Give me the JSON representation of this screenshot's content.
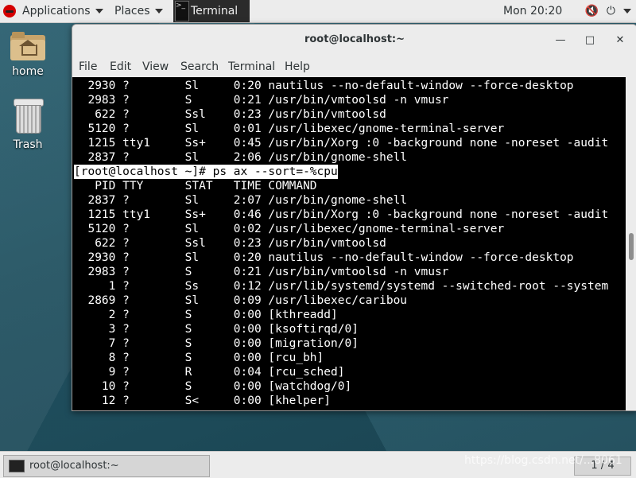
{
  "top_panel": {
    "applications": "Applications",
    "places": "Places",
    "terminal_task": "Terminal",
    "clock": "Mon 20:20"
  },
  "desktop": {
    "home_label": "home",
    "trash_label": "Trash"
  },
  "window": {
    "title": "root@localhost:~",
    "menu": [
      "File",
      "Edit",
      "View",
      "Search",
      "Terminal",
      "Help"
    ]
  },
  "terminal": {
    "lines": [
      "  2930 ?        Sl     0:20 nautilus --no-default-window --force-desktop",
      "  2983 ?        S      0:21 /usr/bin/vmtoolsd -n vmusr",
      "   622 ?        Ssl    0:23 /usr/bin/vmtoolsd",
      "  5120 ?        Sl     0:01 /usr/libexec/gnome-terminal-server",
      "  1215 tty1     Ss+    0:45 /usr/bin/Xorg :0 -background none -noreset -audit",
      "  2837 ?        Sl     2:06 /usr/bin/gnome-shell",
      "[root@localhost ~]# ps ax --sort=-%cpu",
      "   PID TTY      STAT   TIME COMMAND",
      "  2837 ?        Sl     2:07 /usr/bin/gnome-shell",
      "  1215 tty1     Ss+    0:46 /usr/bin/Xorg :0 -background none -noreset -audit",
      "  5120 ?        Sl     0:02 /usr/libexec/gnome-terminal-server",
      "   622 ?        Ssl    0:23 /usr/bin/vmtoolsd",
      "  2930 ?        Sl     0:20 nautilus --no-default-window --force-desktop",
      "  2983 ?        S      0:21 /usr/bin/vmtoolsd -n vmusr",
      "     1 ?        Ss     0:12 /usr/lib/systemd/systemd --switched-root --system",
      "  2869 ?        Sl     0:09 /usr/libexec/caribou",
      "     2 ?        S      0:00 [kthreadd]",
      "     3 ?        S      0:00 [ksoftirqd/0]",
      "     7 ?        S      0:00 [migration/0]",
      "     8 ?        S      0:00 [rcu_bh]",
      "     9 ?        R      0:04 [rcu_sched]",
      "    10 ?        S      0:00 [watchdog/0]",
      "    12 ?        S<     0:00 [khelper]"
    ]
  },
  "bottom_panel": {
    "task_label": "root@localhost:~",
    "workspace": "1 / 4"
  },
  "watermark": "https://blog.csdn.net/...8061"
}
